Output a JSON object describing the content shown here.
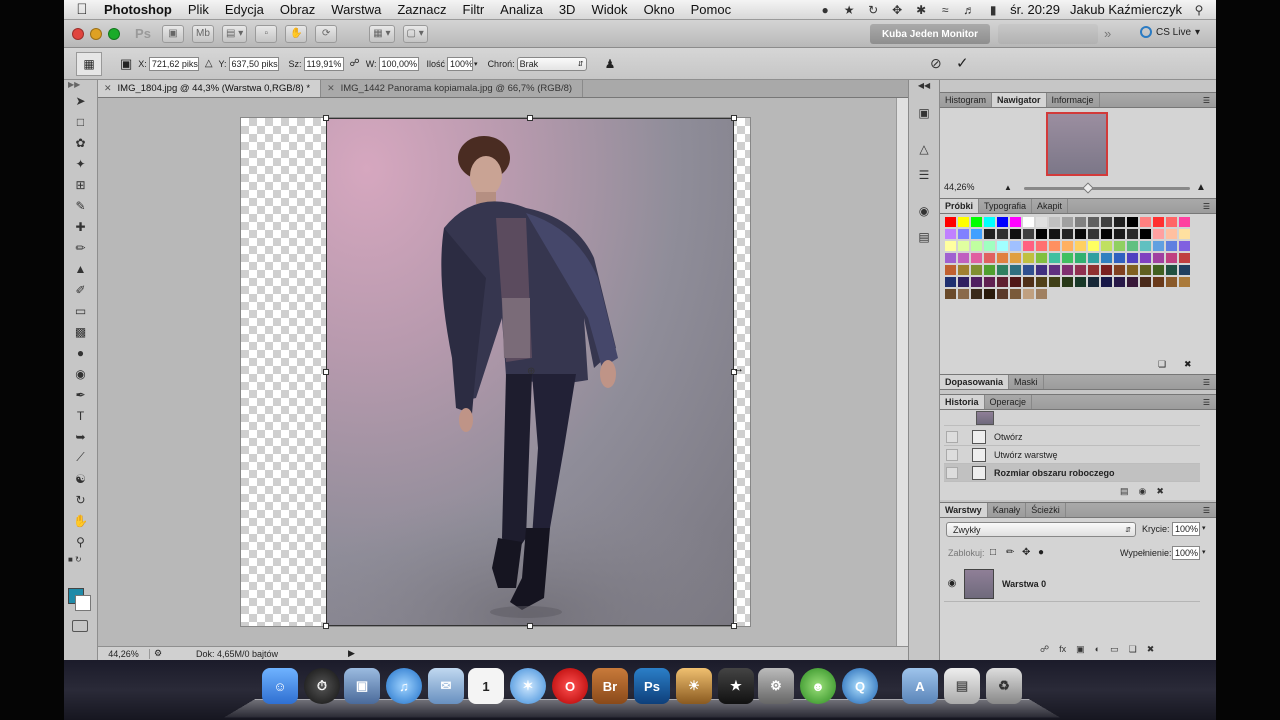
{
  "menubar": {
    "app": "Photoshop",
    "items": [
      "Plik",
      "Edycja",
      "Obraz",
      "Warstwa",
      "Zaznacz",
      "Filtr",
      "Analiza",
      "3D",
      "Widok",
      "Okno",
      "Pomoc"
    ],
    "clock": "śr. 20:29",
    "user": "Jakub Kaźmierczyk"
  },
  "appbar": {
    "ps_logo": "Ps",
    "mb_label": "Mb",
    "workspace": "Kuba Jeden Monitor",
    "cslive": "CS Live"
  },
  "options": {
    "x_label": "X:",
    "x_value": "721,62 piks",
    "y_label": "Y:",
    "y_value": "637,50 piks",
    "w_label": "Sz:",
    "w_value": "119,91%",
    "h_label": "W:",
    "h_value": "100,00%",
    "amount_label": "Ilość",
    "amount_value": "100%",
    "protect_label": "Chroń:",
    "protect_value": "Brak"
  },
  "tabs": [
    {
      "label": "IMG_1804.jpg @ 44,3% (Warstwa 0,RGB/8) *",
      "active": true
    },
    {
      "label": "IMG_1442 Panorama kopiamala.jpg @ 66,7% (RGB/8)",
      "active": false
    }
  ],
  "status": {
    "zoom": "44,26%",
    "doc": "Dok: 4,65M/0 bajtów"
  },
  "navigator": {
    "tabs": [
      "Histogram",
      "Nawigator",
      "Informacje"
    ],
    "active": 1,
    "zoom": "44,26%"
  },
  "swatches": {
    "tabs": [
      "Próbki",
      "Typografia",
      "Akapit"
    ],
    "active": 0,
    "colors": [
      "#ff0000",
      "#ffff00",
      "#00ff00",
      "#00ffff",
      "#0000ff",
      "#ff00ff",
      "#ffffff",
      "#e0e0e0",
      "#c0c0c0",
      "#a0a0a0",
      "#808080",
      "#606060",
      "#404040",
      "#202020",
      "#000000",
      "#ff8080",
      "#ff3030",
      "#ff6666",
      "#ff40a0",
      "#c080ff",
      "#8080ff",
      "#40a0ff",
      "#202020",
      "#303030",
      "#101010",
      "#404040",
      "#000000",
      "#151515",
      "#252525",
      "#0a0a0a",
      "#353535",
      "#050505",
      "#1a1a1a",
      "#2a2a2a",
      "#000000",
      "#ffa0a0",
      "#ffc0a0",
      "#ffe0a0",
      "#ffffa0",
      "#e0ffa0",
      "#c0ffa0",
      "#a0ffc0",
      "#a0ffff",
      "#a0c0ff",
      "#ff6080",
      "#ff7070",
      "#ff9060",
      "#ffb060",
      "#ffd060",
      "#ffff60",
      "#c0e060",
      "#90d060",
      "#60c080",
      "#60c0c0",
      "#60a0e0",
      "#6080e0",
      "#8060e0",
      "#a060d0",
      "#c060c0",
      "#e060a0",
      "#e06060",
      "#e08040",
      "#e0a040",
      "#c0c040",
      "#80c040",
      "#40c0a0",
      "#40c060",
      "#30b070",
      "#30a0a0",
      "#3080c0",
      "#3060c0",
      "#5040c0",
      "#8040c0",
      "#a040a0",
      "#c04080",
      "#c04040",
      "#c06030",
      "#a08030",
      "#809030",
      "#50a030",
      "#308060",
      "#307080",
      "#305090",
      "#403080",
      "#603080",
      "#803070",
      "#903050",
      "#903030",
      "#7a2020",
      "#804020",
      "#806020",
      "#606020",
      "#406020",
      "#205040",
      "#204060",
      "#203070",
      "#302060",
      "#502060",
      "#602050",
      "#602030",
      "#501818",
      "#503018",
      "#504018",
      "#404018",
      "#283818",
      "#183828",
      "#182838",
      "#181848",
      "#281848",
      "#381838",
      "#4a2a1a",
      "#6a3a1a",
      "#8a5a2a",
      "#aa7a3a",
      "#6a4a2a",
      "#8a6a4a",
      "#3a2a1a",
      "#2a1a0a",
      "#5a3a2a",
      "#7a5a3a",
      "#c0a080",
      "#a08060"
    ]
  },
  "adjust": {
    "tabs": [
      "Dopasowania",
      "Maski"
    ],
    "active": 0
  },
  "history": {
    "tabs": [
      "Historia",
      "Operacje"
    ],
    "active": 0,
    "items": [
      "Otwórz",
      "Utwórz warstwę",
      "Rozmiar obszaru roboczego"
    ]
  },
  "layers": {
    "tabs": [
      "Warstwy",
      "Kanały",
      "Ścieżki"
    ],
    "active": 0,
    "blend": "Zwykły",
    "opacity_label": "Krycie:",
    "opacity": "100%",
    "lock_label": "Zablokuj:",
    "fill_label": "Wypełnienie:",
    "fill": "100%",
    "layer_name": "Warstwa 0"
  },
  "dock": {
    "apps": [
      "Finder",
      "Dashboard",
      "Preview",
      "iTunes",
      "Mail",
      "iCal",
      "Safari",
      "Opera",
      "Bridge",
      "Photoshop",
      "iPhoto",
      "Instruments",
      "System Preferences",
      "Adium",
      "QuickTime",
      "Applications",
      "Documents",
      "Trash"
    ],
    "br_label": "Br",
    "ps_label": "Ps",
    "ical_day": "1"
  },
  "colors": {
    "foreground": "#1f8aa8",
    "background": "#ffffff"
  }
}
